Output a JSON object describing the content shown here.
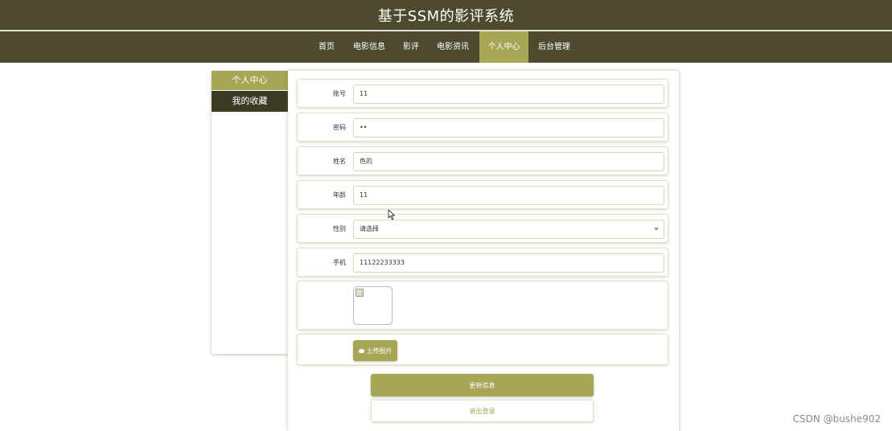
{
  "app": {
    "title": "基于SSM的影评系统"
  },
  "nav": {
    "items": [
      {
        "label": "首页"
      },
      {
        "label": "电影信息"
      },
      {
        "label": "影评"
      },
      {
        "label": "电影资讯"
      },
      {
        "label": "个人中心",
        "active": true
      },
      {
        "label": "后台管理"
      }
    ]
  },
  "sidebar": {
    "items": [
      {
        "label": "个人中心",
        "active": true
      },
      {
        "label": "我的收藏"
      }
    ]
  },
  "form": {
    "account": {
      "label": "账号",
      "value": "11"
    },
    "password": {
      "label": "密码",
      "value": "••"
    },
    "name": {
      "label": "姓名",
      "value": "色的"
    },
    "age": {
      "label": "年龄",
      "value": "11"
    },
    "gender": {
      "label": "性别",
      "value": "请选择"
    },
    "phone": {
      "label": "手机",
      "value": "11122233333"
    },
    "upload_label": "上传图片",
    "update_label": "更新信息",
    "logout_label": "退出登录"
  },
  "watermark": "CSDN @bushe902",
  "colors": {
    "header": "#4d4a2e",
    "accent": "#a6a655",
    "sidebar_dark": "#3d3a24"
  },
  "icons": {
    "upload": "cloud-upload-icon",
    "select": "chevron-down-icon",
    "cursor": "mouse-pointer-icon"
  }
}
